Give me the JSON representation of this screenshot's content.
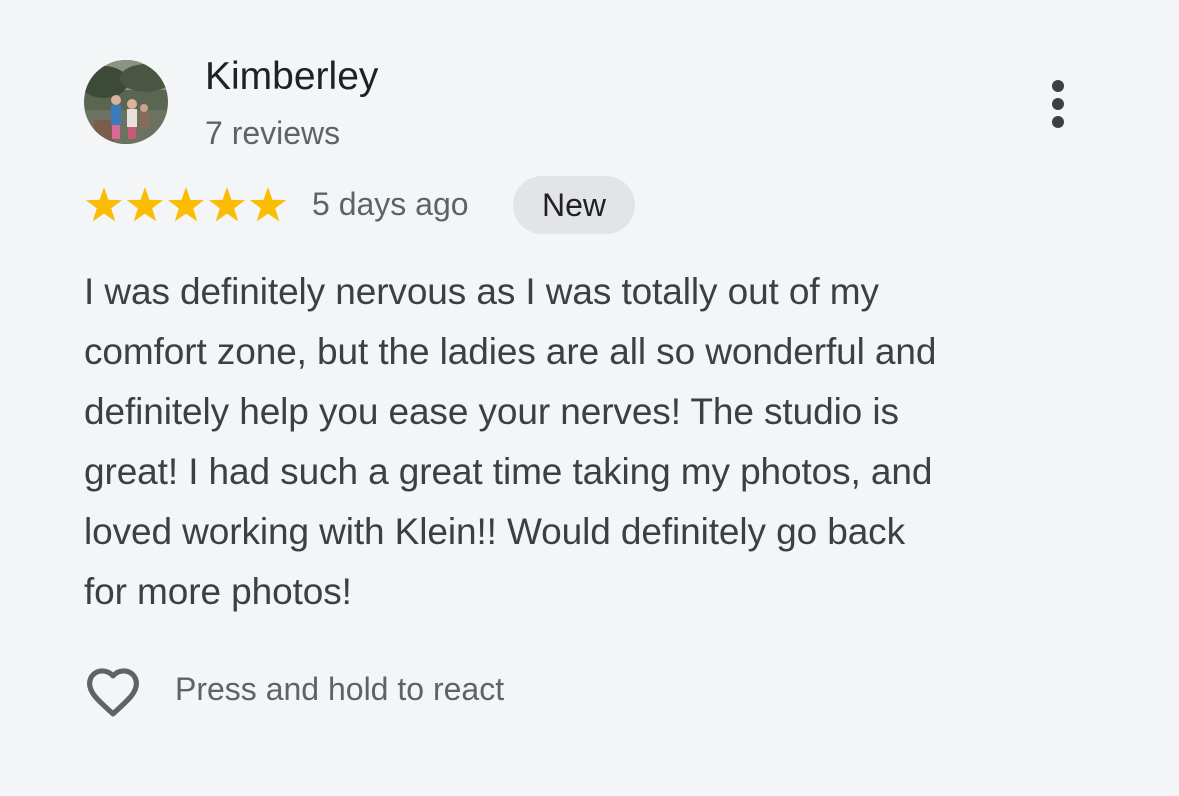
{
  "reviewer": {
    "name": "Kimberley",
    "review_count": "7 reviews",
    "avatar_icon": "avatar-photo-icon"
  },
  "menu": {
    "icon": "more-vert-icon"
  },
  "rating": {
    "stars": 5,
    "max_stars": 5,
    "star_color": "#fbbc04",
    "date": "5 days ago",
    "badge": "New"
  },
  "review": {
    "lines": [
      "I was definitely nervous as I was totally out of my",
      "comfort zone, but the ladies are all so wonderful and",
      "definitely help you ease your nerves! The studio is",
      "great! I had such a great time taking my photos, and",
      "loved working with Klein!! Would definitely go back",
      "for more photos!"
    ]
  },
  "reaction": {
    "icon": "heart-outline-icon",
    "label": "Press and hold to react"
  },
  "colors": {
    "background": "#f4f5f7",
    "badge_background": "#e3e4e7",
    "primary_text": "#202124",
    "secondary_text": "#5f6368"
  }
}
